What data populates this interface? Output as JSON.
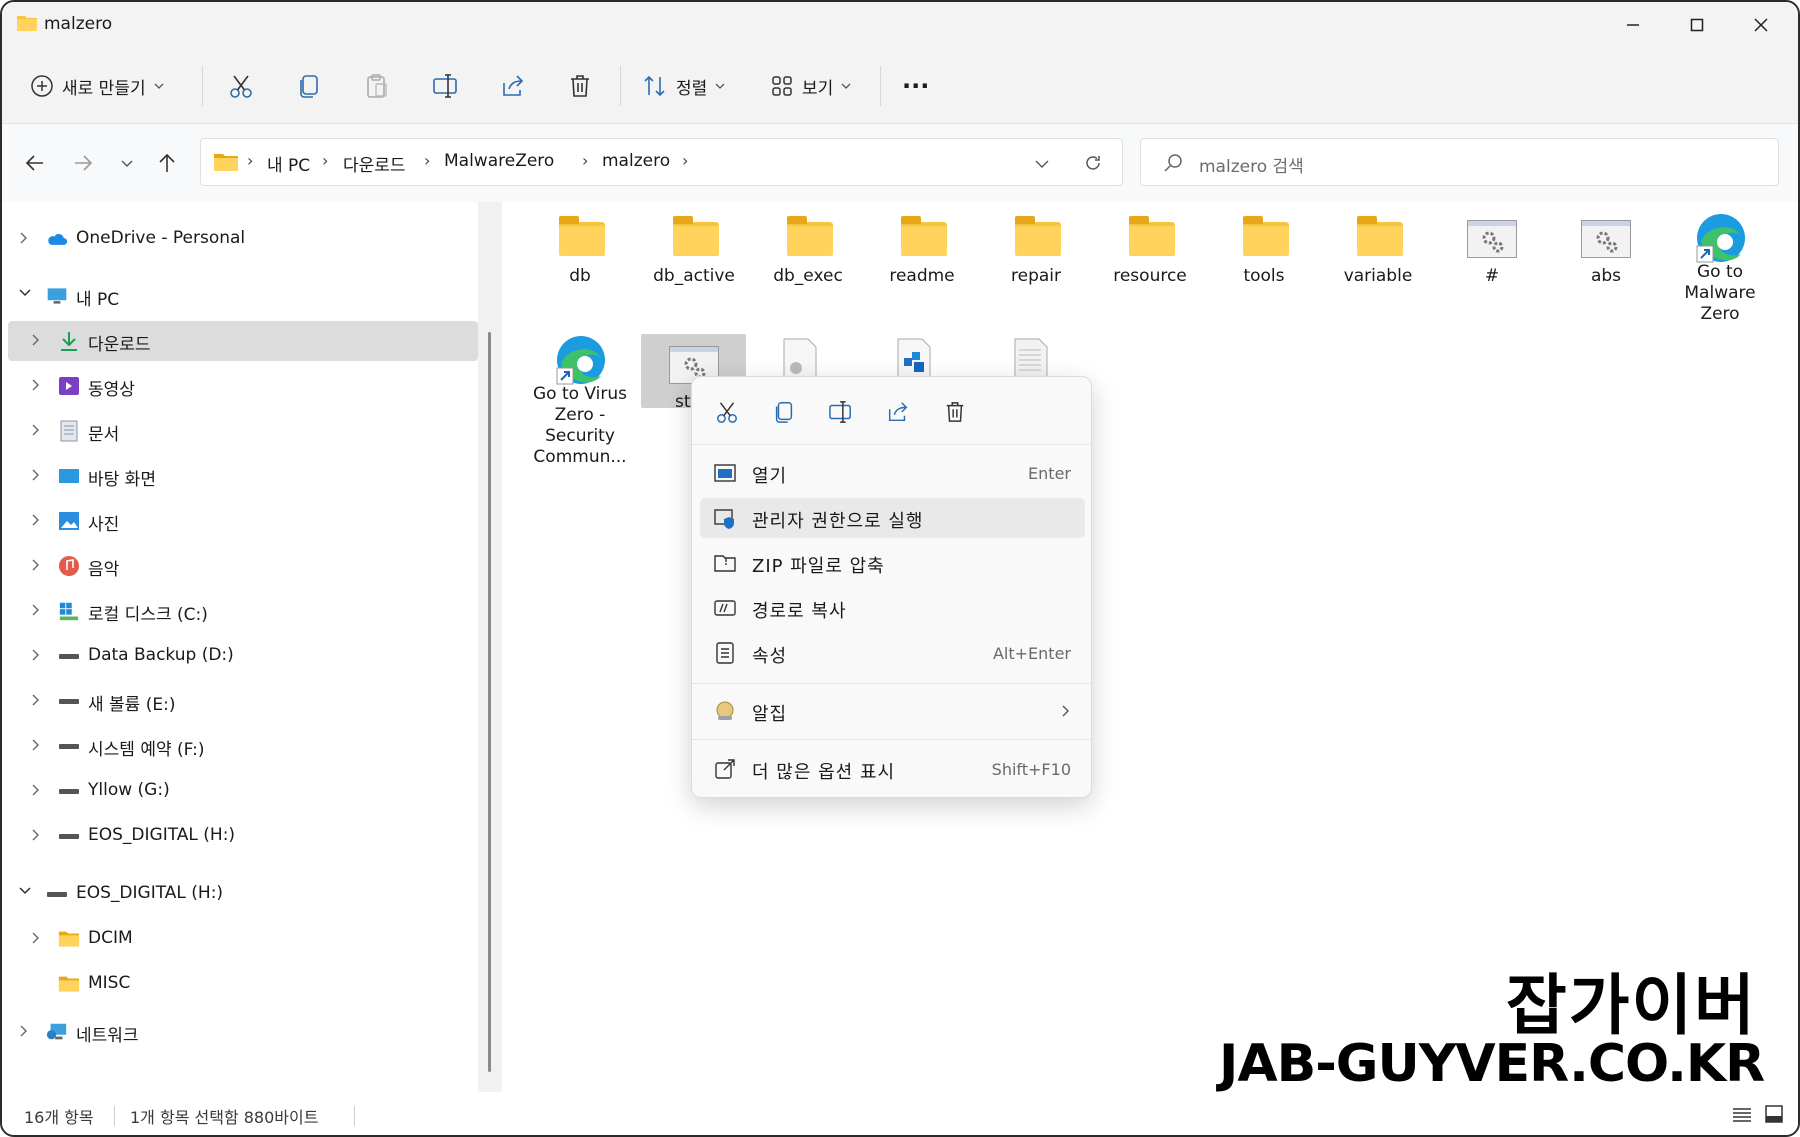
{
  "window": {
    "title": "malzero"
  },
  "toolbar": {
    "new_label": "새로 만들기",
    "sort_label": "정렬",
    "view_label": "보기",
    "more_label": "···"
  },
  "address": {
    "crumbs": [
      "내 PC",
      "다운로드",
      "MalwareZero",
      "malzero"
    ],
    "search_placeholder": "malzero 검색"
  },
  "sidebar": {
    "items": [
      {
        "label": "OneDrive - Personal"
      },
      {
        "label": "내 PC"
      },
      {
        "label": "다운로드"
      },
      {
        "label": "동영상"
      },
      {
        "label": "문서"
      },
      {
        "label": "바탕 화면"
      },
      {
        "label": "사진"
      },
      {
        "label": "음악"
      },
      {
        "label": "로컬 디스크 (C:)"
      },
      {
        "label": "Data Backup (D:)"
      },
      {
        "label": "새 볼륨 (E:)"
      },
      {
        "label": "시스템 예약 (F:)"
      },
      {
        "label": "Yllow (G:)"
      },
      {
        "label": "EOS_DIGITAL (H:)"
      },
      {
        "label": "EOS_DIGITAL (H:)"
      },
      {
        "label": "DCIM"
      },
      {
        "label": "MISC"
      },
      {
        "label": "네트워크"
      }
    ]
  },
  "files": [
    {
      "name": "db",
      "icon": "folder"
    },
    {
      "name": "db_active",
      "icon": "folder"
    },
    {
      "name": "db_exec",
      "icon": "folder"
    },
    {
      "name": "readme",
      "icon": "folder"
    },
    {
      "name": "repair",
      "icon": "folder"
    },
    {
      "name": "resource",
      "icon": "folder"
    },
    {
      "name": "tools",
      "icon": "folder"
    },
    {
      "name": "variable",
      "icon": "folder"
    },
    {
      "name": "#",
      "icon": "config-file"
    },
    {
      "name": "abs",
      "icon": "config-file"
    },
    {
      "name": "Go to Malware Zero",
      "icon": "edge-shortcut"
    },
    {
      "name": "Go to Virus Zero - Security Commun...",
      "icon": "edge-shortcut"
    },
    {
      "name": "st",
      "icon": "config-file"
    }
  ],
  "context_menu": {
    "items": [
      {
        "label": "열기",
        "shortcut": "Enter"
      },
      {
        "label": "관리자 권한으로 실행",
        "shortcut": ""
      },
      {
        "label": "ZIP 파일로 압축",
        "shortcut": ""
      },
      {
        "label": "경로로 복사",
        "shortcut": ""
      },
      {
        "label": "속성",
        "shortcut": "Alt+Enter"
      },
      {
        "label": "알집",
        "shortcut": ""
      },
      {
        "label": "더 많은 옵션 표시",
        "shortcut": "Shift+F10"
      }
    ]
  },
  "status": {
    "count": "16개 항목",
    "selection": "1개 항목 선택함 880바이트"
  },
  "watermark": {
    "line1": "잡가이버",
    "line2": "JAB-GUYVER.CO.KR"
  }
}
